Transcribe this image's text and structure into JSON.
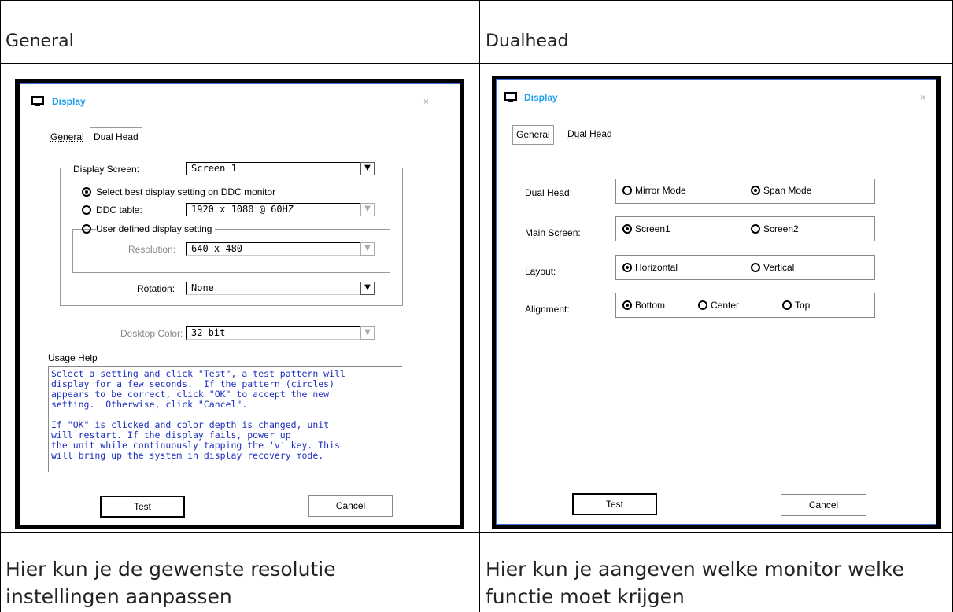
{
  "table": {
    "headers": [
      "General",
      "Dualhead"
    ],
    "captions": [
      "Hier kun je de gewenste resolutie instellingen aanpassen",
      "Hier kun je aangeven welke monitor welke functie moet krijgen"
    ]
  },
  "colors": {
    "title": "#1ea0f0",
    "help_text": "#1d2fbf",
    "dialog_border": "#3b6fd8"
  },
  "left_dialog": {
    "title": "Display",
    "close": "×",
    "tabs": [
      "General",
      "Dual Head"
    ],
    "display_screen_label": "Display Screen:",
    "display_screen_value": "Screen 1",
    "radio_best": "Select best display setting on DDC monitor",
    "radio_ddc": "DDC table:",
    "ddc_value": "1920 x 1080 @ 60HZ",
    "radio_user": "User defined display setting",
    "resolution_label": "Resolution:",
    "resolution_value": "640 x 480",
    "rotation_label": "Rotation:",
    "rotation_value": "None",
    "desktop_color_label": "Desktop Color:",
    "desktop_color_value": "32 bit",
    "usage_help_label": "Usage Help",
    "usage_help_text": "Select a setting and click \"Test\", a test pattern will\ndisplay for a few seconds.  If the pattern (circles)\nappears to be correct, click \"OK\" to accept the new\nsetting.  Otherwise, click \"Cancel\".\n\nIf \"OK\" is clicked and color depth is changed, unit\nwill restart. If the display fails, power up\nthe unit while continuously tapping the 'v' key. This\nwill bring up the system in display recovery mode.",
    "test_button": "Test",
    "cancel_button": "Cancel"
  },
  "right_dialog": {
    "title": "Display",
    "close": "×",
    "tabs": [
      "General",
      "Dual Head"
    ],
    "dual_head_label": "Dual Head:",
    "mirror_mode": "Mirror Mode",
    "span_mode": "Span Mode",
    "main_screen_label": "Main Screen:",
    "screen1": "Screen1",
    "screen2": "Screen2",
    "layout_label": "Layout:",
    "horizontal": "Horizontal",
    "vertical": "Vertical",
    "alignment_label": "Alignment:",
    "bottom": "Bottom",
    "center": "Center",
    "top": "Top",
    "test_button": "Test",
    "cancel_button": "Cancel"
  }
}
